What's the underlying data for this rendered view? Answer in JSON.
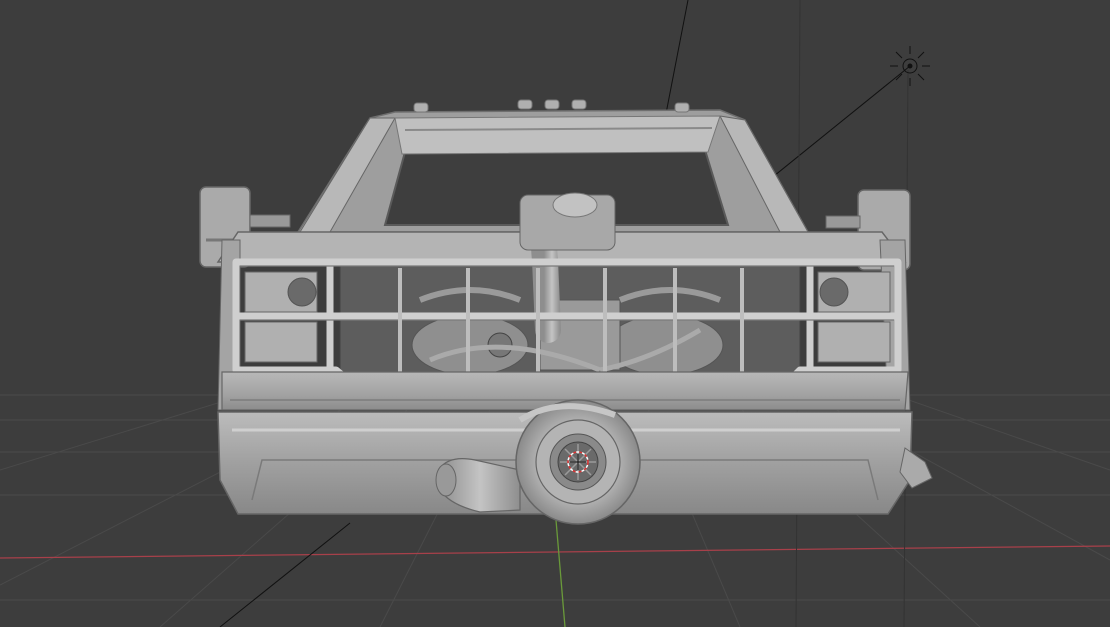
{
  "app": {
    "name": "",
    "view": "3D Viewport"
  },
  "viewport": {
    "background": "#3d3d3d",
    "grid_color": "#4a4a4a",
    "x_axis_color": "#a8404a",
    "y_axis_color": "#6a9a3a",
    "model_color": "#a9a9a9",
    "model_shadow": "#6f6f6f",
    "model_highlight": "#d2d2d2",
    "line_color": "#101010"
  },
  "scene": {
    "object": "truck-front-model",
    "shading": "solid",
    "has_3d_cursor": true,
    "has_light": true,
    "has_camera_lines": true
  }
}
